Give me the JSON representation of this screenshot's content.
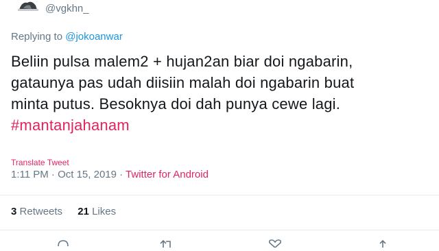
{
  "tweet": {
    "handle": "@vgkhn_",
    "reply_prefix": "Replying to",
    "reply_to": "@jokoanwar",
    "text_lines": [
      "Beliin pulsa malem2 + hujan2an biar doi ngabarin,",
      "gataunya pas udah diisiin malah doi ngabarin buat",
      "minta putus. Besoknya doi dah punya cewe lagi."
    ],
    "hashtag": "#mantanjahanam",
    "translate_label": "Translate Tweet",
    "timestamp": "1:11 PM · Oct 15, 2019 · ",
    "source": "Twitter for Android",
    "retweets_count": "3",
    "retweets_label": "Retweets",
    "likes_count": "21",
    "likes_label": "Likes"
  },
  "colors": {
    "accent": "#e0245e",
    "link": "#1b95e0",
    "muted": "#657786",
    "text": "#14171a",
    "divider": "#e6ecf0"
  },
  "icons": [
    "reply-icon",
    "retweet-icon",
    "like-icon",
    "share-icon"
  ]
}
